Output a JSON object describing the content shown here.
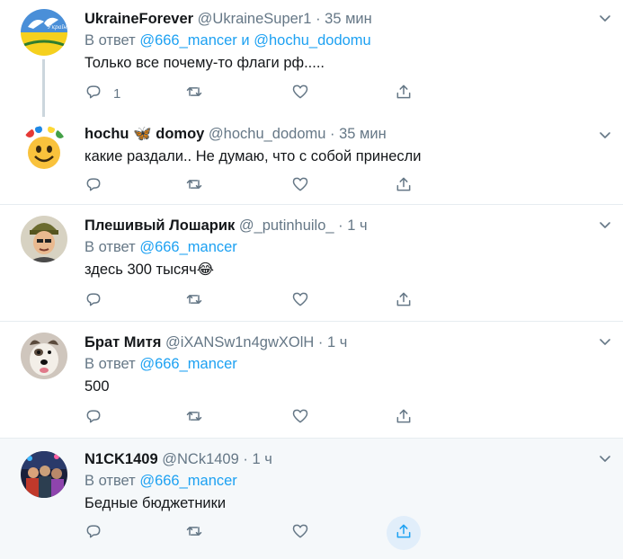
{
  "tweets": [
    {
      "name": "UkraineForever",
      "handle": "@UkraineSuper1",
      "dot": "·",
      "time": "35 мин",
      "reply_prefix": "В ответ",
      "reply_to": [
        "@666_mancer",
        "и",
        "@hochu_dodomu"
      ],
      "text": "Только все почему-то флаги рф.....",
      "reply_count": "1",
      "avatar": "ukraine-flag-doves-avatar"
    },
    {
      "name": "hochu",
      "name_emoji": "🦋",
      "name_suffix": "domoy",
      "handle": "@hochu_dodomu",
      "dot": "·",
      "time": "35 мин",
      "text": "какие раздали.. Не думаю, что с собой принесли",
      "avatar": "smiley-wreath-avatar"
    },
    {
      "name": "Плешивый Лошарик",
      "handle": "@_putinhuilo_",
      "dot": "·",
      "time": "1 ч",
      "reply_prefix": "В ответ",
      "reply_to": [
        "@666_mancer"
      ],
      "text": "здесь 300 тысяч😂",
      "avatar": "cartoon-man-avatar"
    },
    {
      "name": "Брат Митя",
      "handle": "@iXANSw1n4gwXOlH",
      "dot": "·",
      "time": "1 ч",
      "reply_prefix": "В ответ",
      "reply_to": [
        "@666_mancer"
      ],
      "text": "500",
      "avatar": "dog-avatar"
    },
    {
      "name": "N1CK1409",
      "handle": "@NCk1409",
      "dot": "·",
      "time": "1 ч",
      "reply_prefix": "В ответ",
      "reply_to": [
        "@666_mancer"
      ],
      "text": "Бедные бюджетники",
      "avatar": "group-photo-avatar"
    }
  ],
  "colors": {
    "link": "#1da1f2",
    "muted": "#657786",
    "text": "#14171a",
    "border": "#e6ecf0",
    "highlight_bg": "#f5f8fa"
  }
}
